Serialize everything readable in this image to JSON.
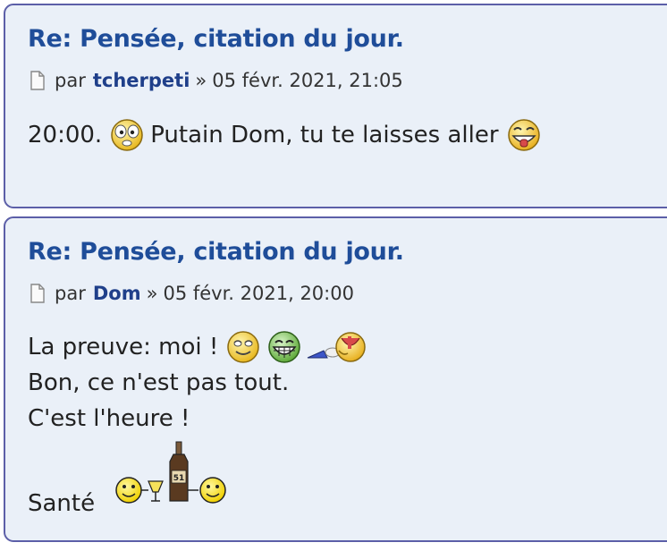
{
  "posts": [
    {
      "title": "Re: Pensée, citation du jour.",
      "by_label": "par",
      "author": "tcherpeti",
      "separator": "»",
      "date": "05 févr. 2021, 21:05",
      "body": {
        "text_before": "20:00.",
        "text_middle": "Putain Dom, tu te laisses aller"
      }
    },
    {
      "title": "Re: Pensée, citation du jour.",
      "by_label": "par",
      "author": "Dom",
      "separator": "»",
      "date": "05 févr. 2021, 20:00",
      "body": {
        "line1": "La preuve: moi !",
        "line2": "Bon, ce n'est pas tout.",
        "line3": "C'est l'heure !",
        "line4": "Santé"
      }
    }
  ],
  "icons": [
    "document-icon",
    "dazed-smiley-icon",
    "tongue-smiley-icon",
    "happy-smiley-icon",
    "big-grin-smiley-icon",
    "drinking-smiley-icon",
    "cheers-smileys-icon"
  ],
  "colors": {
    "title": "#1f4d99",
    "border": "#5c5fa8",
    "background": "#eaf0f8"
  }
}
